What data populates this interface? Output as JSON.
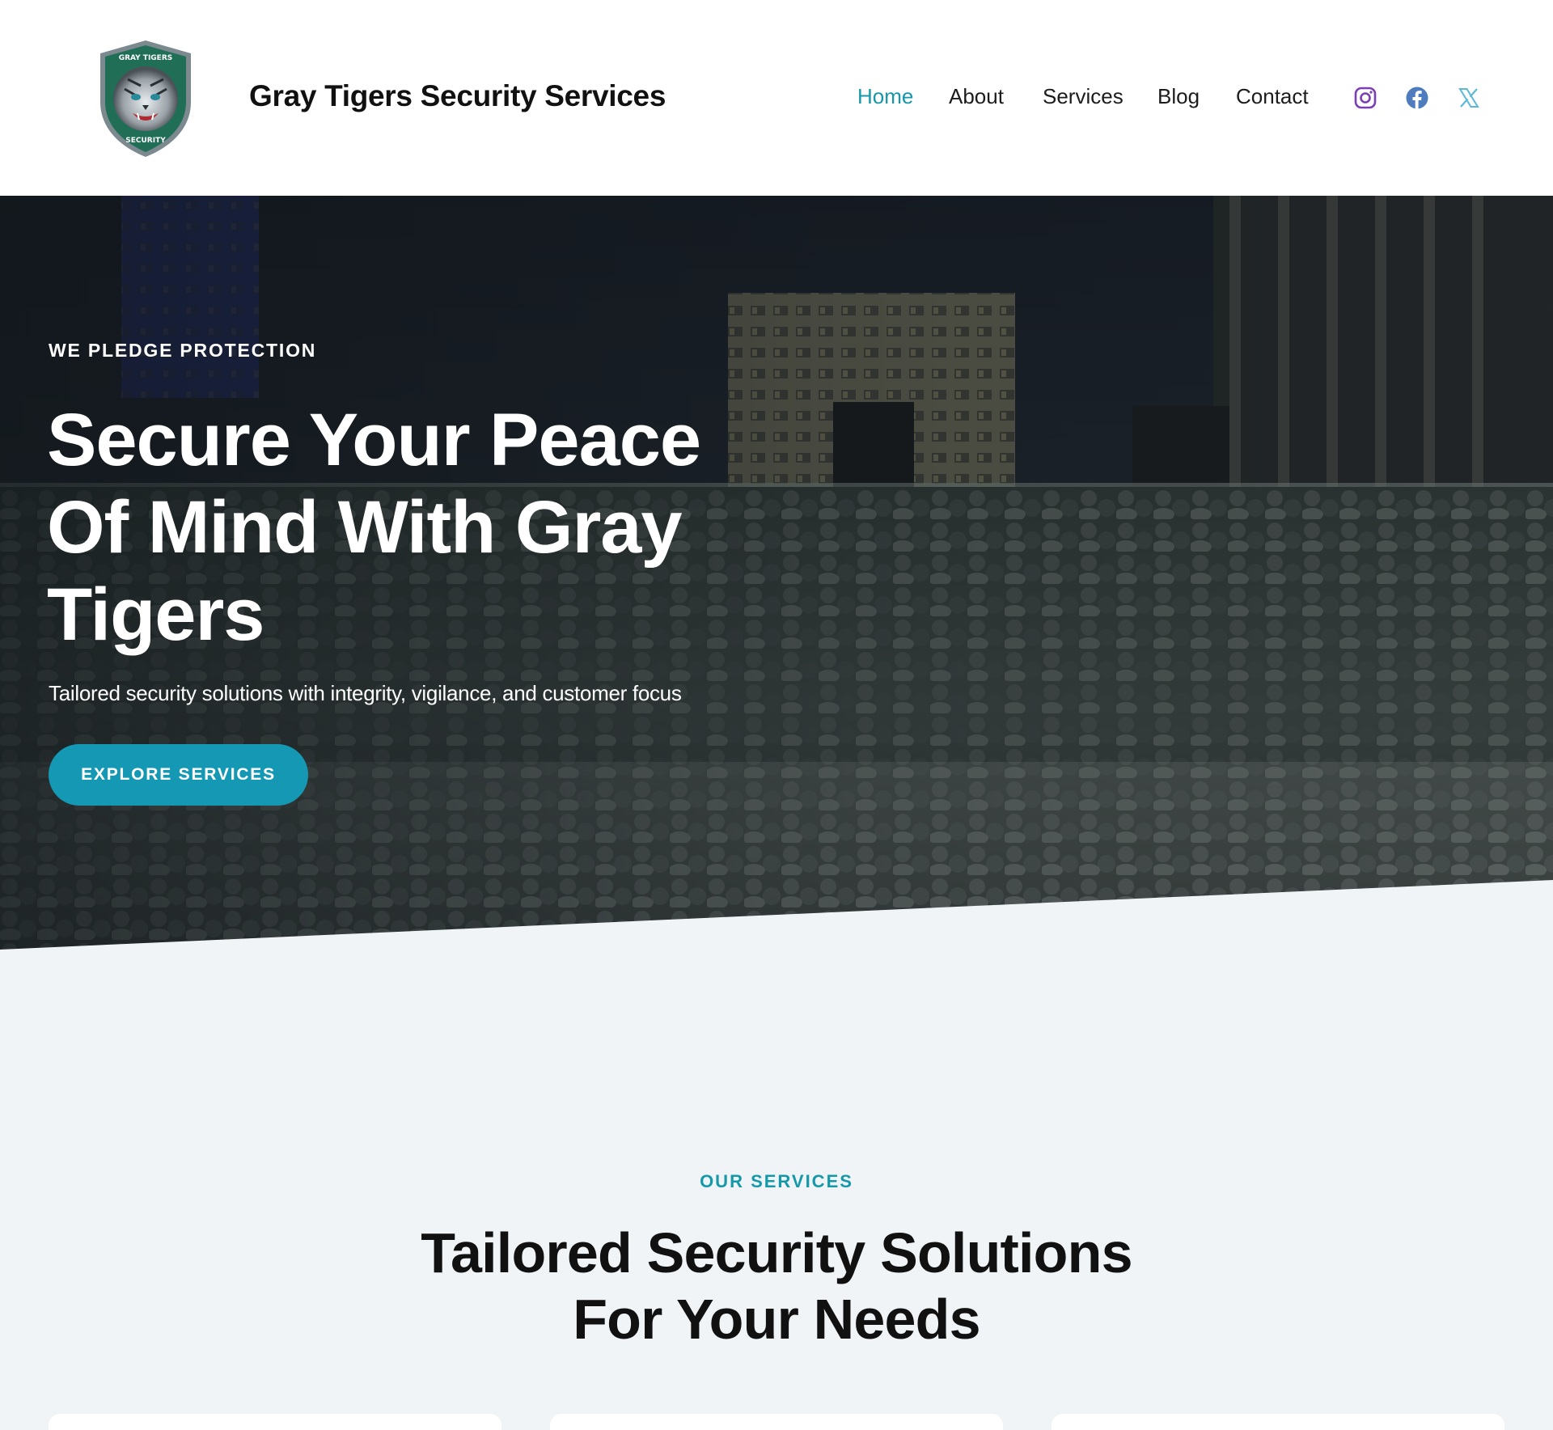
{
  "header": {
    "site_title": "Gray Tigers Security Services",
    "logo": {
      "icon": "tiger-shield-logo",
      "text_top": "GRAY TIGERS",
      "text_bottom": "SECURITY"
    },
    "nav": {
      "home": "Home",
      "about": "About",
      "services": "Services",
      "blog": "Blog",
      "contact": "Contact",
      "active": "Home"
    },
    "social": [
      {
        "icon": "instagram-icon",
        "color": "#7b3fb3"
      },
      {
        "icon": "facebook-icon",
        "color": "#4f7bbf"
      },
      {
        "icon": "x-twitter-icon",
        "color": "#5ab8d8"
      }
    ]
  },
  "hero": {
    "eyebrow": "WE PLEDGE PROTECTION",
    "title": "Secure Your Peace Of Mind With Gray Tigers",
    "subtitle": "Tailored security solutions with integrity, vigilance, and customer focus",
    "cta": "EXPLORE SERVICES",
    "background": "night-concert-crowd-photo"
  },
  "services": {
    "eyebrow": "OUR SERVICES",
    "title": "Tailored Security Solutions For Your Needs"
  },
  "colors": {
    "accent": "#1598a8",
    "button": "#1598b3",
    "section_bg": "#f0f4f7",
    "text_dark": "#111111"
  }
}
